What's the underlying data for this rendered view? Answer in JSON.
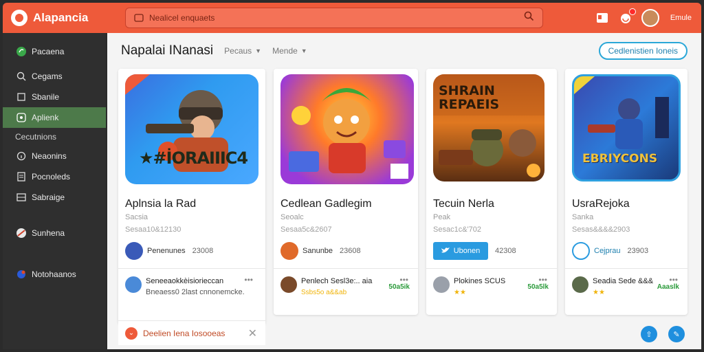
{
  "app": {
    "name": "Alapancia"
  },
  "search": {
    "placeholder": "Nealicel enquaets"
  },
  "header": {
    "username": "Emule"
  },
  "sidebar": {
    "items": [
      {
        "label": "Pacaena",
        "icon": "leaf-icon"
      },
      {
        "label": "Cegams",
        "icon": "search-icon"
      },
      {
        "label": "Sbanile",
        "icon": "square-icon"
      },
      {
        "label": "Aplienk",
        "icon": "apps-icon",
        "active": true
      },
      {
        "label": "Cecutnions",
        "icon": ""
      },
      {
        "label": "Neaonins",
        "icon": "info-icon"
      },
      {
        "label": "Pocnoleds",
        "icon": "document-icon"
      },
      {
        "label": "Sabraige",
        "icon": "storage-icon"
      },
      {
        "label": "Sunhena",
        "icon": "ball-icon"
      },
      {
        "label": "Notohaanos",
        "icon": "globe-icon"
      }
    ]
  },
  "main": {
    "title": "Napalai INanasi",
    "filters": [
      "Pecaus",
      "Mende"
    ],
    "cta": "Cedlenistien Ioneis"
  },
  "cards": [
    {
      "name": "Aplnsia la Rad",
      "category": "Sacsia",
      "meta": "Sesaa10&12130",
      "art_title": "★#İORAIIIC4",
      "developer": "Penenunes",
      "count": "23008",
      "review_text": "Seneeaokkèisiorieccan",
      "review_text2": "Bneaess0 2last cnnonemcke.",
      "review_more": "•••"
    },
    {
      "name": "Cedlean Gadlegim",
      "category": "Seoalc",
      "meta": "Sesaa5c&2607",
      "developer": "Sanunbe",
      "count": "23608",
      "review_text": "Penlech Sesl3e:.. aia",
      "review_text2": "Ssbs5o a&&ab",
      "review_price": "50a5ik",
      "review_more": "•••"
    },
    {
      "name": "Tecuin Nerla",
      "category": "Peak",
      "meta": "Sesac1c&'702",
      "art_title": "SHRAIN REPAEIS",
      "developer": "Ubonen",
      "count": "42308",
      "review_text": "Plokines SCUS",
      "review_text2": "★★",
      "review_price": "50a5lk",
      "review_more": "•••"
    },
    {
      "name": "UsraRejoka",
      "category": "Sanka",
      "meta": "Sesas&&&&2903",
      "art_title": "EBRIYCONS",
      "developer": "Cejprau",
      "count": "23903",
      "review_text": "Seadia Sede &&&",
      "review_text2": "★★",
      "review_price": "Aaaslk",
      "review_more": "•••"
    }
  ],
  "bottom": {
    "label": "Deelien Iena Iosooeas",
    "close": "✕"
  },
  "colors": {
    "brand": "#ee5a3a",
    "active_nav": "#4d7a4a",
    "accent_blue": "#2a9be0",
    "price_green": "#2a9a3a"
  }
}
